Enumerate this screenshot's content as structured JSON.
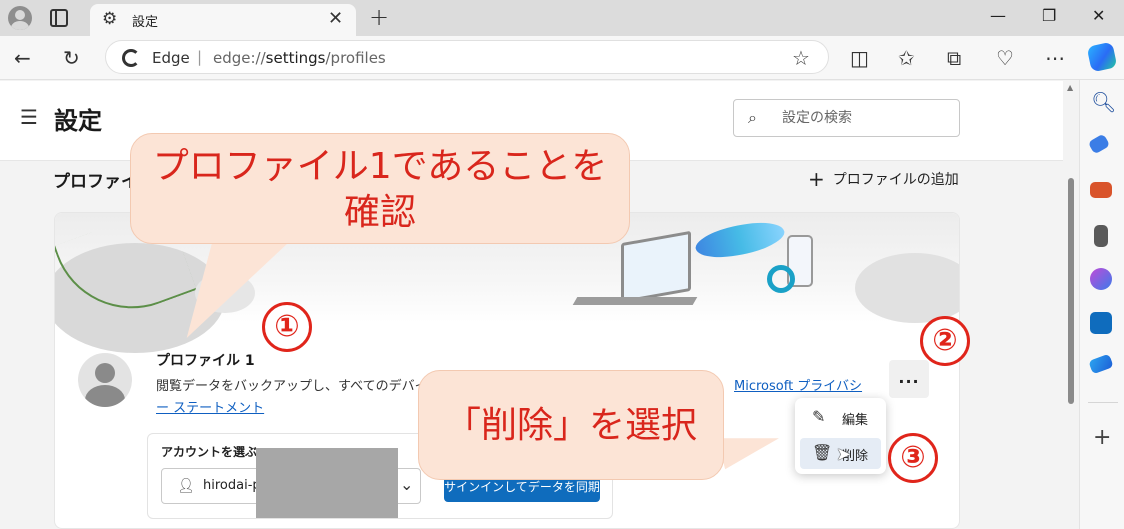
{
  "browser": {
    "tab_title": "設定",
    "address_brand": "Edge",
    "url_prefix": "edge://",
    "url_bold": "settings",
    "url_suffix": "/profiles"
  },
  "settings": {
    "title": "設定",
    "search_placeholder": "設定の検索"
  },
  "profiles": {
    "section_title": "プロファイル",
    "add_profile": "プロファイルの追加",
    "profile_name": "プロファイル 1",
    "description": "閲覧データをバックアップし、すべてのデバイス",
    "privacy_link": "Microsoft プライバシ",
    "statement_link": "ー ステートメント",
    "more_label": "...",
    "account_label": "アカウントを選ぶ",
    "account_value": "hirodai-p",
    "signin_button": "サインインしてデータを同期"
  },
  "context_menu": {
    "items": [
      {
        "label": "編集",
        "icon": "pencil-icon"
      },
      {
        "label": "削除",
        "icon": "trash-icon"
      }
    ]
  },
  "annotations": {
    "callout1_line1": "プロファイル1であることを",
    "callout1_line2": "確認",
    "callout2": "「削除」を選択",
    "num1": "①",
    "num2": "②",
    "num3": "③",
    "accent_color": "#e0251b",
    "callout_color": "#fce4d6"
  }
}
